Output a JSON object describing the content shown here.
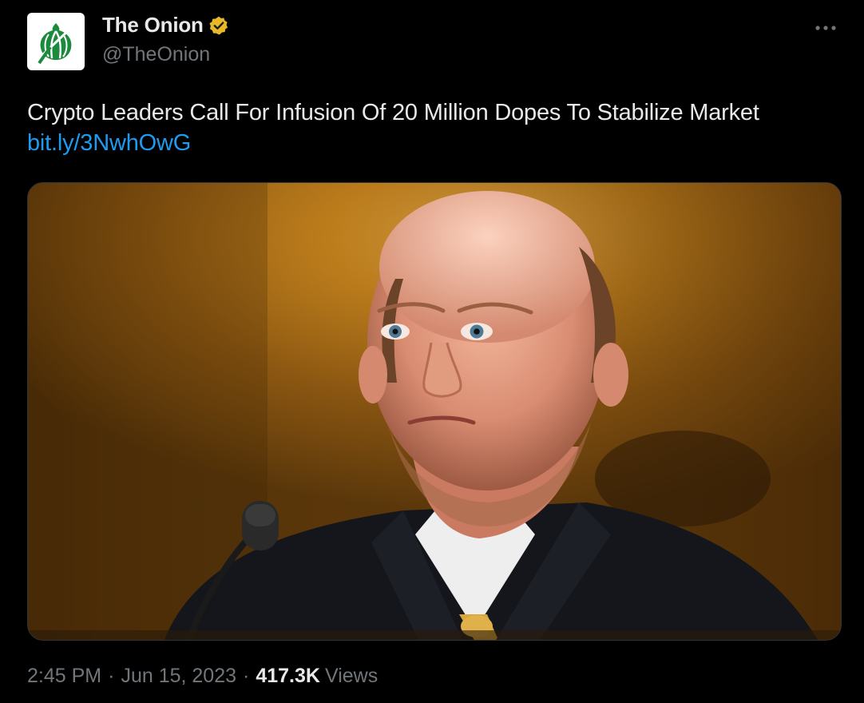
{
  "account": {
    "display_name": "The Onion",
    "handle": "@TheOnion",
    "verified_badge": "gold-verified-icon",
    "avatar_icon": "onion-logo-icon",
    "avatar_bg": "#ffffff",
    "avatar_fg": "#1a8a3c"
  },
  "tweet": {
    "text": "Crypto Leaders Call For Infusion Of 20 Million Dopes To Stabilize Market",
    "link": "bit.ly/3NwhOwG"
  },
  "media": {
    "type": "photo",
    "subject": "man-at-microphone-photo"
  },
  "meta": {
    "time": "2:45 PM",
    "date": "Jun 15, 2023",
    "separator": "·",
    "views_count": "417.3K",
    "views_label": "Views"
  },
  "colors": {
    "background": "#000000",
    "text": "#e7e9ea",
    "secondary": "#71767b",
    "link": "#1d9bf0",
    "verified_gold": "#e8b829"
  }
}
